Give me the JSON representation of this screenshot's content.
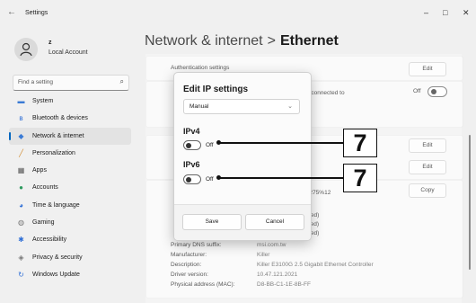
{
  "window": {
    "title": "Settings",
    "back_icon": "back-arrow-icon",
    "min_label": "–",
    "max_label": "□",
    "close_label": "✕"
  },
  "account": {
    "name": "z",
    "type": "Local Account"
  },
  "search": {
    "placeholder": "Find a setting"
  },
  "sidebar": {
    "items": [
      {
        "label": "System",
        "icon": "system-icon",
        "color": "#3a7bd5"
      },
      {
        "label": "Bluetooth & devices",
        "icon": "bluetooth-icon",
        "color": "#2f6fd6"
      },
      {
        "label": "Network & internet",
        "icon": "wifi-icon",
        "color": "#3a7bd5",
        "active": true
      },
      {
        "label": "Personalization",
        "icon": "brush-icon",
        "color": "#d08a2e"
      },
      {
        "label": "Apps",
        "icon": "apps-icon",
        "color": "#555"
      },
      {
        "label": "Accounts",
        "icon": "person-icon",
        "color": "#2e9a5f"
      },
      {
        "label": "Time & language",
        "icon": "globe-clock-icon",
        "color": "#2f6fd6"
      },
      {
        "label": "Gaming",
        "icon": "controller-icon",
        "color": "#777"
      },
      {
        "label": "Accessibility",
        "icon": "accessibility-icon",
        "color": "#2f6fd6"
      },
      {
        "label": "Privacy & security",
        "icon": "shield-icon",
        "color": "#777"
      },
      {
        "label": "Windows Update",
        "icon": "update-icon",
        "color": "#2f6fd6"
      }
    ]
  },
  "header": {
    "crumb": "Network & internet",
    "separator": ">",
    "current": "Ethernet"
  },
  "main": {
    "auth_settings": "Authentication settings",
    "metered_text": "en you're connected to",
    "network_link": "twork",
    "off_label": "Off",
    "edit_label": "Edit",
    "copy_label": "Copy",
    "ipv6_partial": ":57:8275%12",
    "encrypted_1": "rypted)",
    "encrypted_2": "ypted)",
    "encrypted_3": "rypted)",
    "properties": [
      {
        "label": "Primary DNS suffix:",
        "value": "msi.com.tw"
      },
      {
        "label": "Manufacturer:",
        "value": "Killer"
      },
      {
        "label": "Description:",
        "value": "Killer E3100G 2.5 Gigabit Ethernet Controller"
      },
      {
        "label": "Driver version:",
        "value": "10.47.121.2021"
      },
      {
        "label": "Physical address (MAC):",
        "value": "D8-BB-C1-1E-8B-FF"
      }
    ]
  },
  "dialog": {
    "title": "Edit IP settings",
    "mode": "Manual",
    "ipv4_label": "IPv4",
    "ipv4_state": "Off",
    "ipv6_label": "IPv6",
    "ipv6_state": "Off",
    "save_label": "Save",
    "cancel_label": "Cancel"
  },
  "annotations": {
    "ipv4_badge": "7",
    "ipv6_badge": "7"
  }
}
